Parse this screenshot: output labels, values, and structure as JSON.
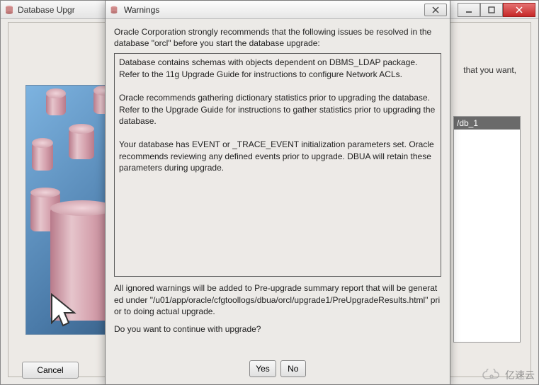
{
  "bg_window": {
    "title": "Database Upgr",
    "right_text": "that you want,",
    "list_selected": "/db_1",
    "cancel_label": "Cancel"
  },
  "dialog": {
    "title": "Warnings",
    "intro": "Oracle Corporation strongly recommends that the following issues be resolved in the database \"orcl\" before you start the database upgrade:",
    "warnings_text": "Database contains schemas with objects dependent on DBMS_LDAP package. Refer to the 11g Upgrade Guide for instructions to configure Network ACLs.\n\nOracle recommends gathering dictionary statistics prior to upgrading the database. Refer to the Upgrade Guide for instructions to gather statistics prior to upgrading the database.\n\nYour database has EVENT or _TRACE_EVENT initialization parameters set. Oracle recommends reviewing any defined events prior to upgrade. DBUA will retain these parameters during upgrade.",
    "footer_text": "All ignored warnings will be added to Pre-upgrade summary report that will be generated under \"/u01/app/oracle/cfgtoollogs/dbua/orcl/upgrade1/PreUpgradeResults.html\" prior to doing actual upgrade.",
    "continue_question": "Do you want to continue with upgrade?",
    "yes_label": "Yes",
    "no_label": "No"
  },
  "watermark": {
    "text": "亿速云"
  }
}
